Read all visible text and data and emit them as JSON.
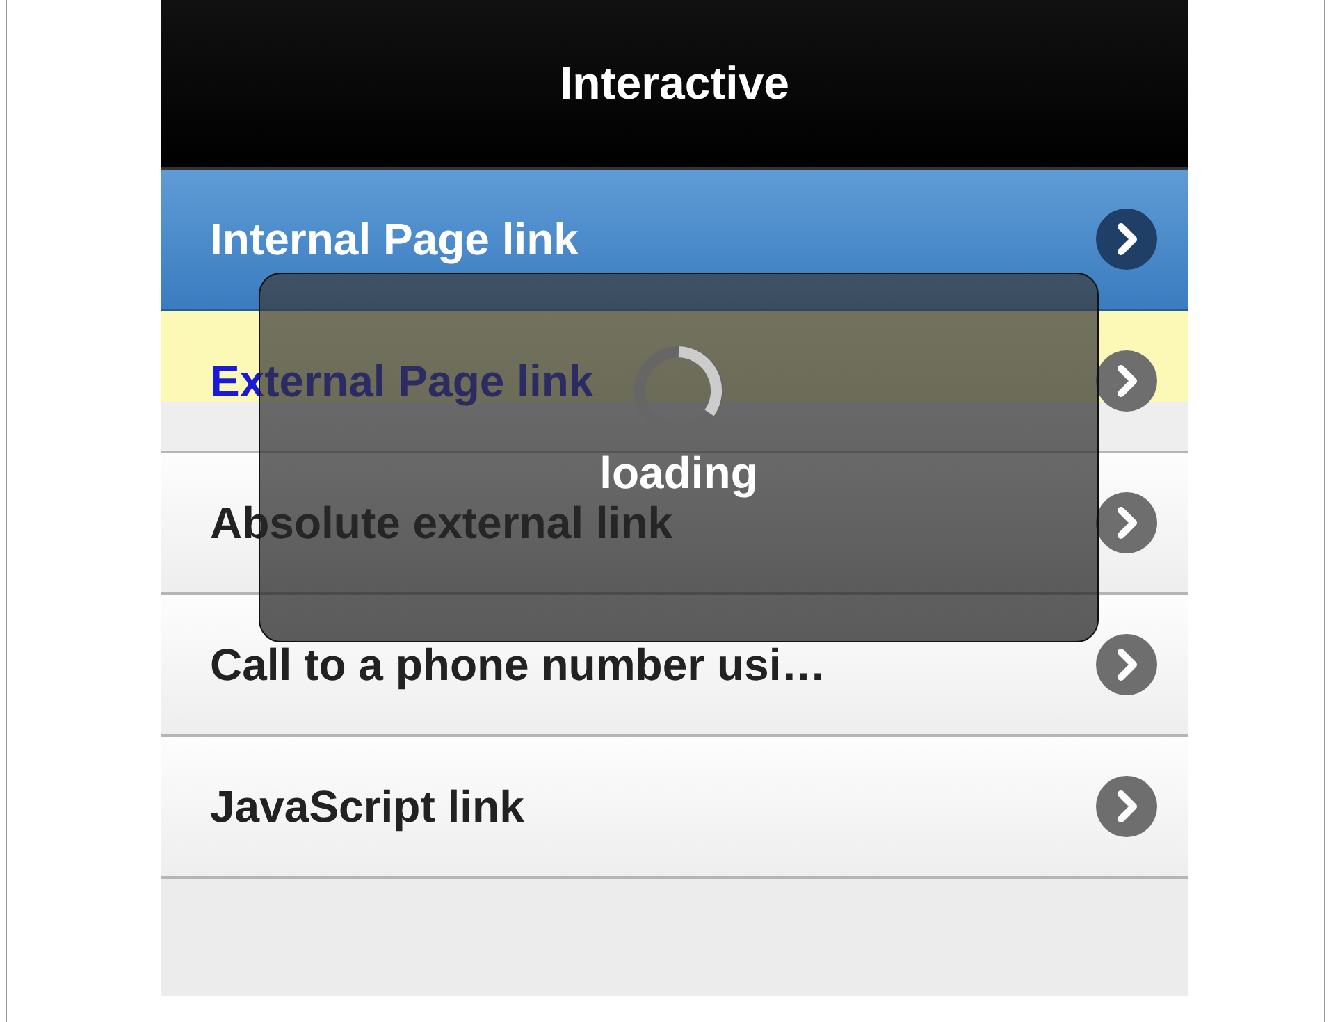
{
  "header": {
    "title": "Interactive"
  },
  "items": [
    {
      "label": "Internal Page link",
      "selected": true,
      "highlighted": false
    },
    {
      "label": "External Page link",
      "selected": false,
      "highlighted": true
    },
    {
      "label": "Absolute external link",
      "selected": false,
      "highlighted": false
    },
    {
      "label": "Call to a phone number usi…",
      "selected": false,
      "highlighted": false
    },
    {
      "label": "JavaScript link",
      "selected": false,
      "highlighted": false
    }
  ],
  "loader": {
    "label": "loading"
  }
}
